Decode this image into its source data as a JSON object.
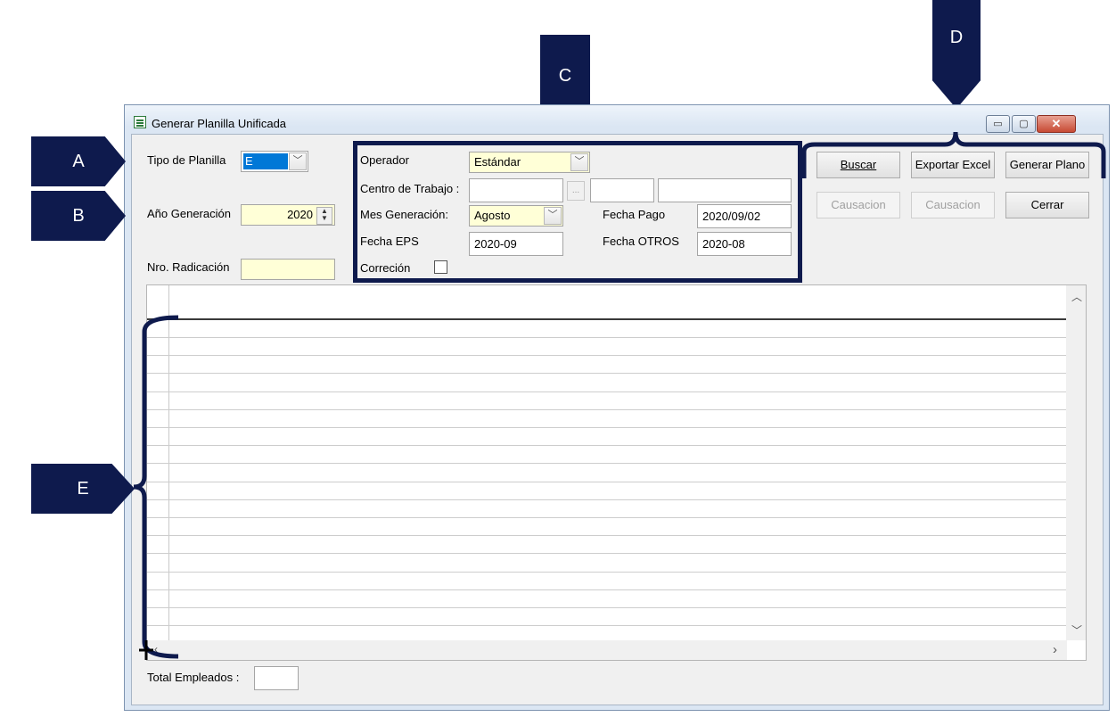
{
  "window": {
    "title": "Generar Planilla Unificada",
    "close_glyph": "✕",
    "min_glyph": "▭",
    "max_glyph": "▢"
  },
  "left_panel": {
    "tipo_label": "Tipo de Planilla",
    "tipo_value": "E",
    "anio_label": "Año Generación",
    "anio_value": "2020",
    "radicacion_label": "Nro. Radicación",
    "radicacion_value": ""
  },
  "center_panel": {
    "operador_label": "Operador",
    "operador_value": "Estándar",
    "centro_label": "Centro de Trabajo :",
    "centro_browse": "...",
    "mes_label": "Mes Generación:",
    "mes_value": "Agosto",
    "fecha_pago_label": "Fecha Pago",
    "fecha_pago_value": "2020/09/02",
    "fecha_eps_label": "Fecha EPS",
    "fecha_eps_value": "2020-09",
    "fecha_otros_label": "Fecha OTROS",
    "fecha_otros_value": "2020-08",
    "correcion_label": "Correción",
    "correcion_checked": false
  },
  "buttons": {
    "buscar": "Buscar",
    "exportar_excel": "Exportar Excel",
    "generar_plano": "Generar Plano",
    "causacion_1": "Causacion",
    "causacion_2": "Causacion",
    "cerrar": "Cerrar"
  },
  "footer": {
    "total_label": "Total Empleados :",
    "total_value": ""
  },
  "grid": {
    "row_count": 17
  },
  "annotations": {
    "a": "A",
    "b": "B",
    "c": "C",
    "d": "D",
    "e": "E",
    "color": "#0e1a4d"
  }
}
